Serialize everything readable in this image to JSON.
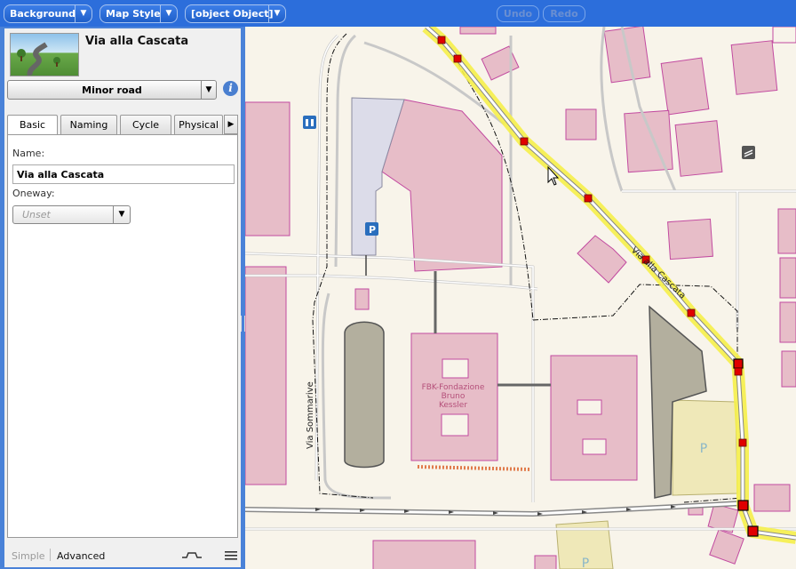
{
  "toolbar": {
    "background_label": "Background",
    "map_style_label": "Map Style",
    "third_label": "[object Object]",
    "undo_label": "Undo",
    "redo_label": "Redo",
    "dropdown_glyph": "▼"
  },
  "panel": {
    "feature_title": "Via alla Cascata",
    "preset_label": "Minor road",
    "info_glyph": "i",
    "tabs": [
      {
        "label": "Basic"
      },
      {
        "label": "Naming"
      },
      {
        "label": "Cycle"
      },
      {
        "label": "Physical"
      }
    ],
    "tab_next_glyph": "▶",
    "fields": {
      "name_label": "Name:",
      "name_value": "Via alla Cascata",
      "oneway_label": "Oneway:",
      "oneway_value": "Unset"
    },
    "footer": {
      "simple_label": "Simple",
      "advanced_label": "Advanced"
    }
  },
  "map": {
    "street_label_1": "Via alla Cascata",
    "street_label_2": "Via Sommarive",
    "building_label": [
      "FBK-Fondazione",
      "Bruno",
      "Kessler"
    ],
    "parking_label": "P",
    "icons": [
      "parking-icon",
      "bicycle-parking-icon",
      "barrier-icon"
    ]
  },
  "colors": {
    "toolbar": "#2c6edb",
    "panel_border": "#4a82d8",
    "map_bg": "#f8f4ea",
    "building": "#e7bdc8",
    "building_stroke": "#c24aa0",
    "highlight": "#f5f04a",
    "node": "#e00000"
  }
}
